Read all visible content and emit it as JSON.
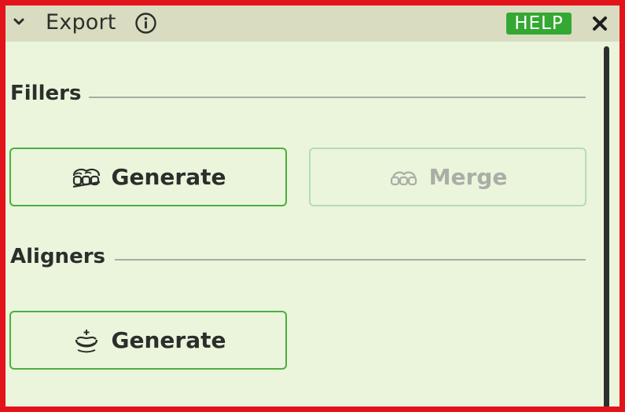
{
  "panel": {
    "title": "Export",
    "help_label": "HELP",
    "icons": {
      "collapse": "chevron-down-icon",
      "info": "info-icon",
      "close": "close-icon"
    }
  },
  "sections": {
    "fillers": {
      "title": "Fillers",
      "generate_label": "Generate",
      "merge_label": "Merge",
      "merge_disabled": true
    },
    "aligners": {
      "title": "Aligners",
      "generate_label": "Generate"
    }
  },
  "colors": {
    "frame_border": "#e3131b",
    "panel_background": "#eaf5dc",
    "header_background": "#d9dcc0",
    "help_badge": "#34a832",
    "button_border": "#4caf3e",
    "button_border_disabled": "#b7dcb0"
  }
}
